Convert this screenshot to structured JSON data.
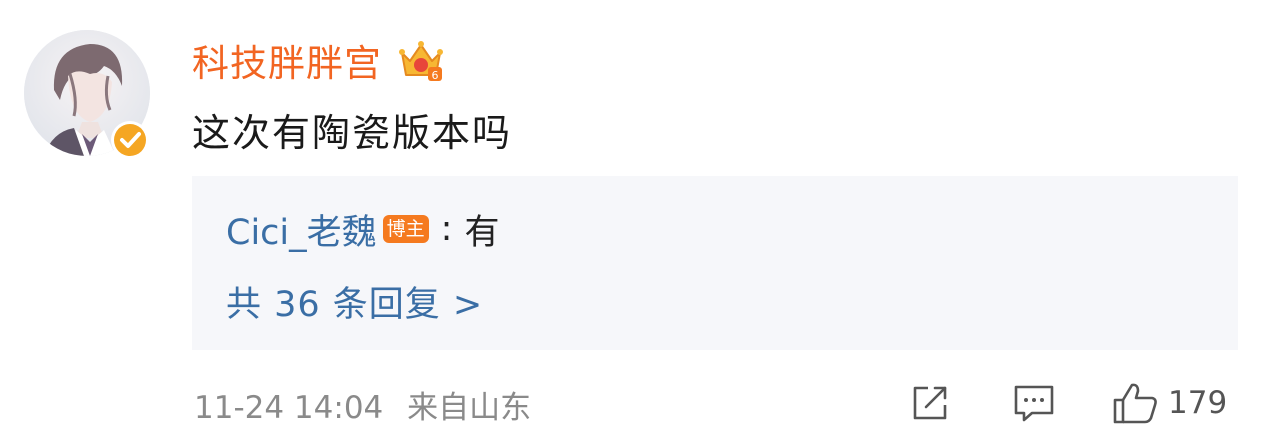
{
  "comment": {
    "username": "科技胖胖宫",
    "text": "这次有陶瓷版本吗",
    "reply": {
      "user": "Cici_老魏",
      "badge": "博主",
      "separator": ":",
      "text": "有",
      "count_label": "共 36 条回复 >"
    },
    "date": "11-24 14:04",
    "location": "来自山东",
    "like_count": "179"
  },
  "colors": {
    "username": "#f26522",
    "link": "#3a6ea5",
    "reply_bg": "#f6f7fa",
    "verified": "#f5a623",
    "badge": "#f57a1f"
  },
  "icons": {
    "avatar": "anime-character-avatar",
    "verified": "verified-badge-icon",
    "member": "crown-level-icon",
    "share": "share-icon",
    "comment": "comment-icon",
    "like": "thumbs-up-icon"
  }
}
